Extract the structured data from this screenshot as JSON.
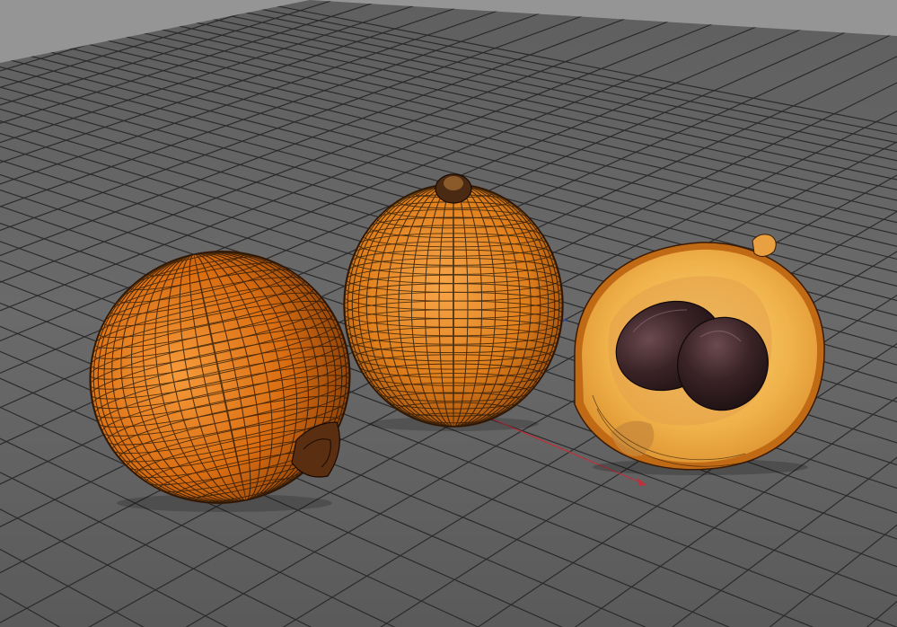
{
  "viewport": {
    "type": "3d-perspective-view",
    "background_color": "#8f8f8f",
    "floor_color": "#666666",
    "grid_line_color": "#2b2b2b",
    "grid_visible": true,
    "wireframe_on_shaded": true,
    "wireframe_color": "#1a1208",
    "axis_colors": {
      "x": "#c0303a",
      "y": "#3050c0"
    }
  },
  "objects": [
    {
      "name": "loquat-whole-tilted",
      "color": "#e07a1a"
    },
    {
      "name": "loquat-whole-upright",
      "color": "#e88a24"
    },
    {
      "name": "loquat-halved",
      "flesh_color": "#f0b24a",
      "seed_color": "#3a2326"
    }
  ]
}
